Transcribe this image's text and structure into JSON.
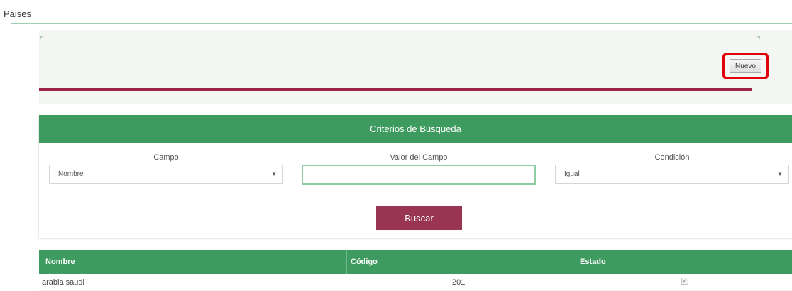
{
  "page": {
    "title": "Paises"
  },
  "toolbar": {
    "new_button_label": "Nuevo"
  },
  "search": {
    "header": "Criterios de Búsqueda",
    "campo_label": "Campo",
    "campo_value": "Nombre",
    "valor_label": "Valor del Campo",
    "valor_value": "",
    "condicion_label": "Condición",
    "condicion_value": "Igual",
    "search_button_label": "Buscar"
  },
  "table": {
    "columns": [
      "Nombre",
      "Código",
      "Estado"
    ],
    "rows": [
      {
        "nombre": "arabia saudi",
        "codigo": "201",
        "estado_checked": true
      }
    ]
  },
  "colors": {
    "header_green": "#3d9b5f",
    "accent_maroon": "#9a3453",
    "highlight_red": "#e0000a"
  }
}
